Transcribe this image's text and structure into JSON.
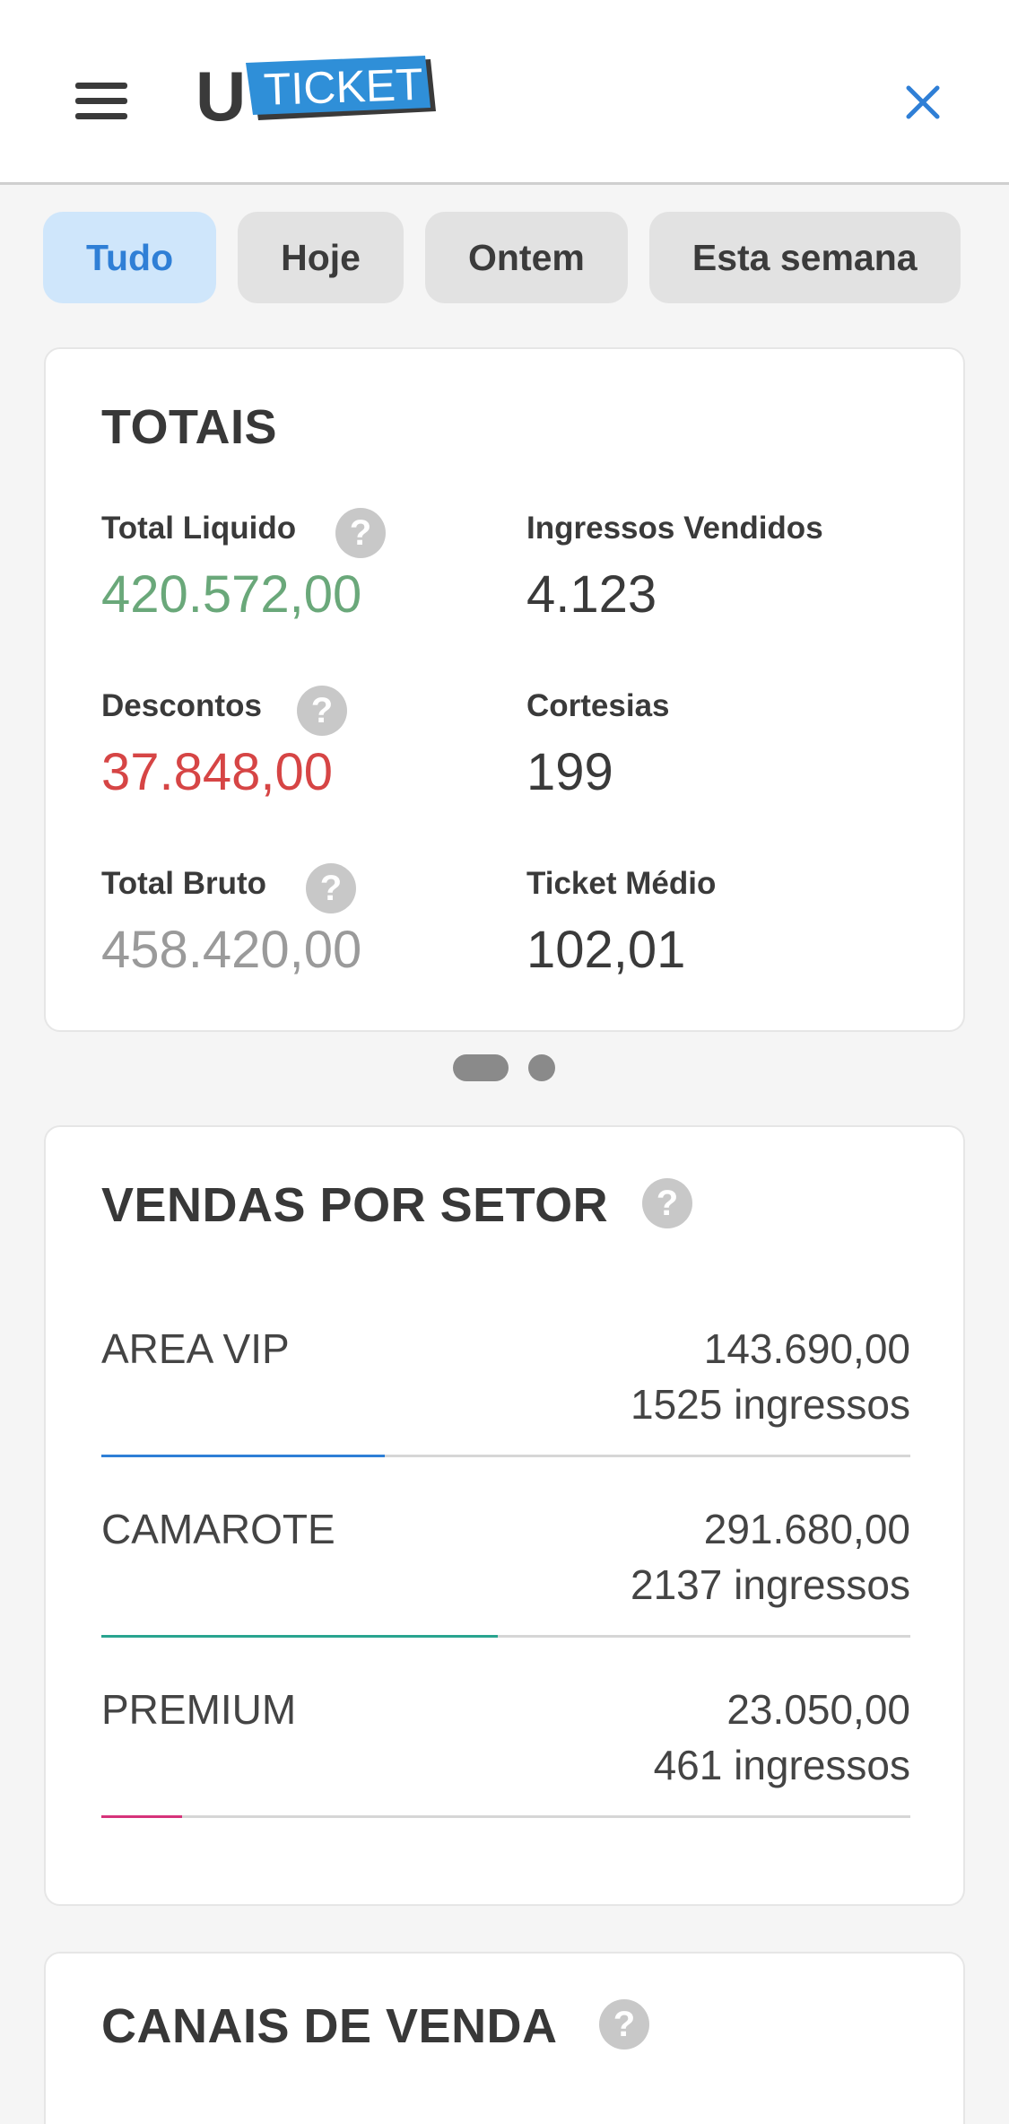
{
  "header": {
    "logo_text": "TICKET",
    "logo_letter": "U"
  },
  "filters": [
    {
      "label": "Tudo",
      "active": true
    },
    {
      "label": "Hoje",
      "active": false
    },
    {
      "label": "Ontem",
      "active": false
    },
    {
      "label": "Esta semana",
      "active": false
    }
  ],
  "totals": {
    "title": "TOTAIS",
    "total_liquido_label": "Total Liquido",
    "total_liquido_value": "420.572,00",
    "ingressos_vendidos_label": "Ingressos Vendidos",
    "ingressos_vendidos_value": "4.123",
    "descontos_label": "Descontos",
    "descontos_value": "37.848,00",
    "cortesias_label": "Cortesias",
    "cortesias_value": "199",
    "total_bruto_label": "Total Bruto",
    "total_bruto_value": "458.420,00",
    "ticket_medio_label": "Ticket Médio",
    "ticket_medio_value": "102,01",
    "help_glyph": "?"
  },
  "colors": {
    "accent": "#2f7fd6",
    "positive": "#6aa87a",
    "negative": "#d64545",
    "muted": "#9a9a9a"
  },
  "sectors": {
    "title": "VENDAS POR SETOR",
    "items": [
      {
        "name": "AREA VIP",
        "value": "143.690,00",
        "count": "1525 ingressos",
        "share": 0.35,
        "color": "#2f7fd6"
      },
      {
        "name": "CAMAROTE",
        "value": "291.680,00",
        "count": "2137 ingressos",
        "share": 0.49,
        "color": "#29a48f"
      },
      {
        "name": "PREMIUM",
        "value": "23.050,00",
        "count": "461 ingressos",
        "share": 0.1,
        "color": "#d6337a"
      }
    ]
  },
  "channels": {
    "title": "CANAIS DE VENDA"
  }
}
